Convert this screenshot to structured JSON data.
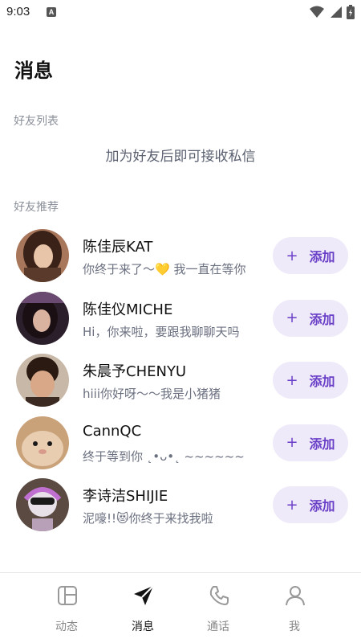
{
  "status_bar": {
    "time": "9:03",
    "app_icon_letter": "A"
  },
  "page": {
    "title": "消息"
  },
  "friends_section": {
    "label": "好友列表",
    "empty_hint": "加为好友后即可接收私信"
  },
  "recommend_section": {
    "label": "好友推荐",
    "add_plus": "+",
    "add_label": "添加",
    "items": [
      {
        "name": "陈佳辰KAT",
        "message": "你终于来了～💛 我一直在等你"
      },
      {
        "name": "陈佳仪MICHE",
        "message": "Hi，你来啦，要跟我聊聊天吗"
      },
      {
        "name": "朱晨予CHENYU",
        "message": "hiii你好呀～～我是小猪猪"
      },
      {
        "name": "CannQC",
        "message": "终于等到你 ˛•ᴗ•˛ ~~~~~~"
      },
      {
        "name": "李诗洁SHIJIE",
        "message": "泥嚎!!😻你终于来找我啦"
      }
    ]
  },
  "tab_bar": {
    "tabs": [
      {
        "label": "动态",
        "icon": "layout-icon"
      },
      {
        "label": "消息",
        "icon": "send-icon"
      },
      {
        "label": "通话",
        "icon": "phone-icon"
      },
      {
        "label": "我",
        "icon": "user-icon"
      }
    ],
    "active_index": 1
  },
  "colors": {
    "accent": "#6a3fc8",
    "button_bg": "#efeaf9",
    "muted_text": "#8a8f99"
  }
}
